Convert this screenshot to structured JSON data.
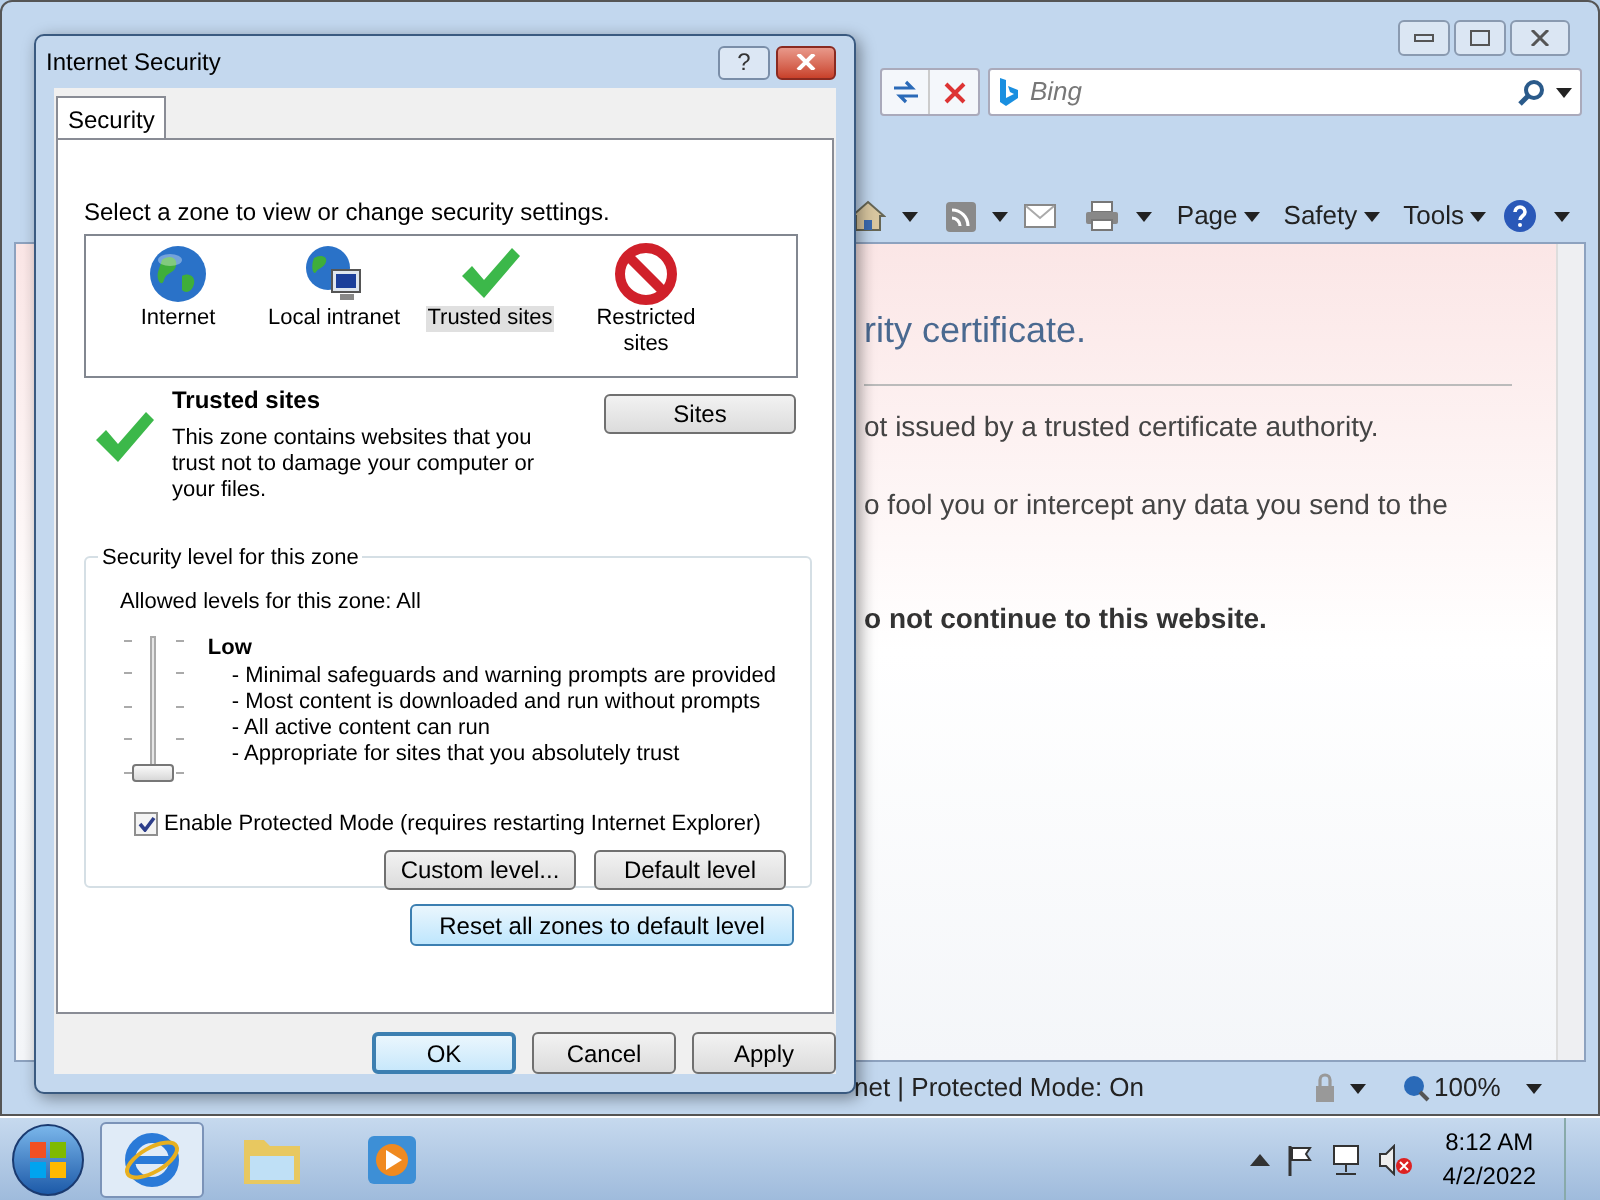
{
  "browser": {
    "search": {
      "placeholder": "Bing"
    },
    "command_bar": [
      {
        "label": "Page"
      },
      {
        "label": "Safety"
      },
      {
        "label": "Tools"
      }
    ],
    "content": {
      "heading": "rity certificate.",
      "lines": [
        "ot issued by a trusted certificate authority.",
        "o fool you or intercept any data you send to the"
      ],
      "warning": "o not continue to this website."
    },
    "status_bar": {
      "zone": "net | Protected Mode: On",
      "zoom": "100%"
    }
  },
  "dialog": {
    "title": "Internet Security",
    "help_button": "?",
    "tabs": [
      {
        "label": "Security",
        "selected": true
      }
    ],
    "prompt": "Select a zone to view or change security settings.",
    "zones": [
      {
        "kind": "internet",
        "label": "Internet",
        "selected": false
      },
      {
        "kind": "intranet",
        "label": "Local intranet",
        "selected": false
      },
      {
        "kind": "trusted",
        "label": "Trusted sites",
        "selected": true
      },
      {
        "kind": "restricted",
        "label": "Restricted sites",
        "selected": false
      }
    ],
    "zone_info": {
      "title": "Trusted sites",
      "description": "This zone contains websites that you trust not to damage your computer or your files."
    },
    "sites_button": "Sites",
    "level_group": {
      "legend": "Security level for this zone",
      "allowed": "Allowed levels for this zone: All",
      "slider": {
        "level": 0
      },
      "level_name": "Low",
      "bullets": [
        "- Minimal safeguards and warning prompts are provided",
        "- Most content is downloaded and run without prompts",
        "- All active content can run",
        "- Appropriate for sites that you absolutely trust"
      ],
      "protected_mode": {
        "label": "Enable Protected Mode (requires restarting Internet Explorer)",
        "checked": true
      },
      "buttons": [
        "Custom level...",
        "Default level"
      ]
    },
    "reset_button": "Reset all zones to default level",
    "footer_buttons": [
      {
        "label": "OK",
        "default": true
      },
      {
        "label": "Cancel",
        "default": false
      },
      {
        "label": "Apply",
        "default": false
      }
    ]
  },
  "taskbar": {
    "apps": [
      {
        "kind": "ie",
        "selected": true
      },
      {
        "kind": "explorer",
        "selected": false
      },
      {
        "kind": "media",
        "selected": false
      }
    ],
    "time": "8:12 AM",
    "date": "4/2/2022"
  }
}
